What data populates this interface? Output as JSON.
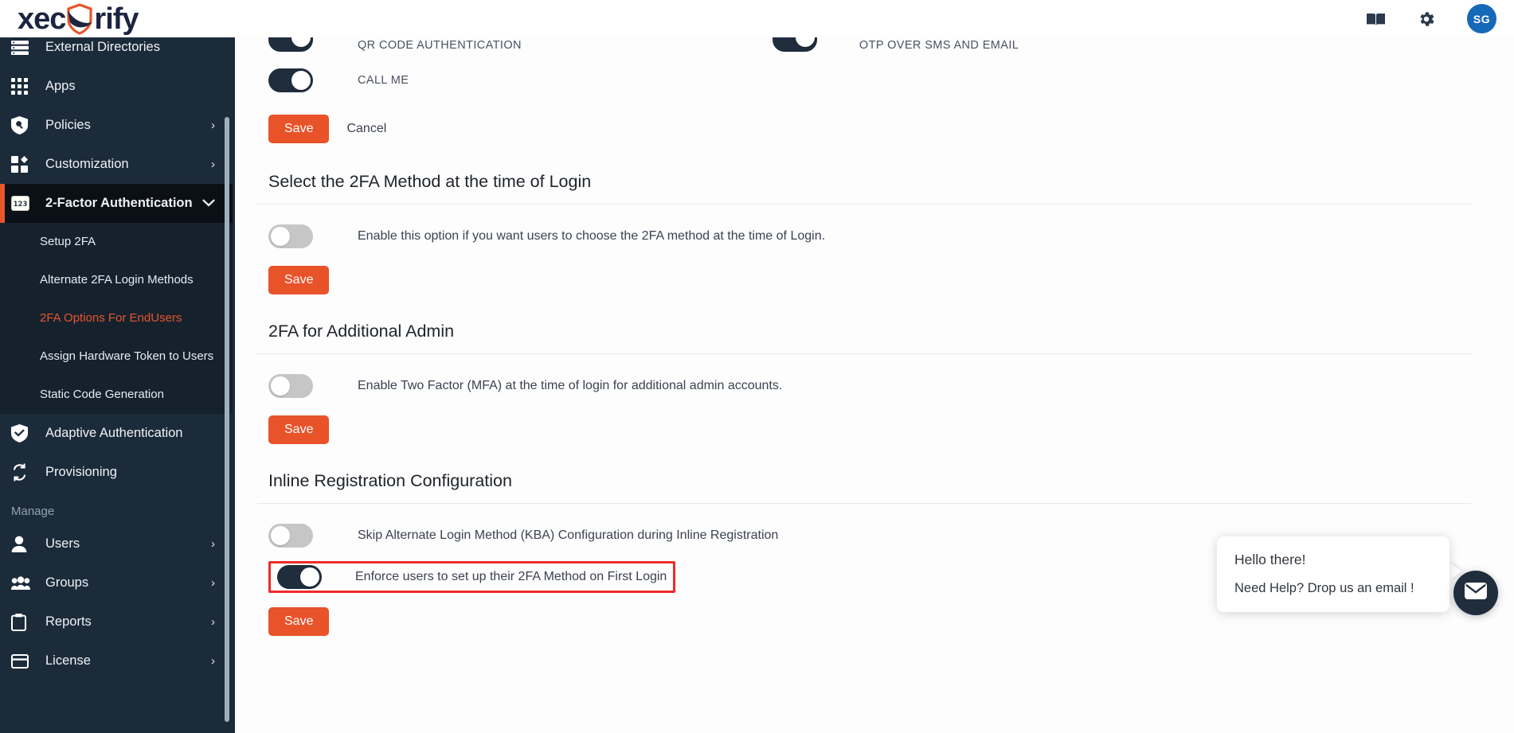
{
  "brand": {
    "name_part1": "xec",
    "name_part2": "rify",
    "shield_icon": "shield-icon"
  },
  "header": {
    "docs_icon": "book-icon",
    "settings_icon": "gear-icon",
    "avatar_initials": "SG"
  },
  "sidebar": {
    "items": [
      {
        "label": "External Directories",
        "icon": "directories-icon",
        "chevron": ""
      },
      {
        "label": "Apps",
        "icon": "apps-grid-icon",
        "chevron": ""
      },
      {
        "label": "Policies",
        "icon": "policy-shield-icon",
        "chevron": "›"
      },
      {
        "label": "Customization",
        "icon": "customization-icon",
        "chevron": "›"
      }
    ],
    "active_item": {
      "label": "2-Factor Authentication",
      "icon": "numpad-123-icon",
      "chevron": "⌄"
    },
    "sub_items": [
      {
        "label": "Setup 2FA",
        "current": false
      },
      {
        "label": "Alternate 2FA Login Methods",
        "current": false
      },
      {
        "label": "2FA Options For EndUsers",
        "current": true
      },
      {
        "label": "Assign Hardware Token to Users",
        "current": false
      },
      {
        "label": "Static Code Generation",
        "current": false
      }
    ],
    "items_after": [
      {
        "label": "Adaptive Authentication",
        "icon": "shield-check-icon",
        "chevron": ""
      },
      {
        "label": "Provisioning",
        "icon": "sync-icon",
        "chevron": ""
      }
    ],
    "section_manage": "Manage",
    "manage_items": [
      {
        "label": "Users",
        "icon": "user-icon",
        "chevron": "›"
      },
      {
        "label": "Groups",
        "icon": "groups-icon",
        "chevron": "›"
      },
      {
        "label": "Reports",
        "icon": "clipboard-icon",
        "chevron": "›"
      },
      {
        "label": "License",
        "icon": "card-icon",
        "chevron": "›"
      }
    ]
  },
  "main": {
    "method_toggles": [
      {
        "label": "QR CODE AUTHENTICATION",
        "on": true
      },
      {
        "label": "OTP OVER SMS AND EMAIL",
        "on": true
      },
      {
        "label": "CALL ME",
        "on": true
      }
    ],
    "methods_save": "Save",
    "methods_cancel": "Cancel",
    "section_select_2fa": {
      "title": "Select the 2FA Method at the time of Login",
      "option_label": "Enable this option if you want users to choose the 2FA method at the time of Login.",
      "option_on": false,
      "save_label": "Save"
    },
    "section_additional_admin": {
      "title": "2FA for Additional Admin",
      "option_label": "Enable Two Factor (MFA) at the time of login for additional admin accounts.",
      "option_on": false,
      "save_label": "Save"
    },
    "section_inline_registration": {
      "title": "Inline Registration Configuration",
      "option1_label": "Skip Alternate Login Method (KBA) Configuration during Inline Registration",
      "option1_on": false,
      "option2_label": "Enforce users to set up their 2FA Method on First Login",
      "option2_on": true,
      "option2_highlighted": true,
      "save_label": "Save"
    }
  },
  "chat_widget": {
    "greeting": "Hello there!",
    "prompt": "Need Help? Drop us an email !",
    "fab_icon": "envelope-icon"
  },
  "colors": {
    "accent_orange": "#e8532a",
    "sidebar_bg": "#1c2b3a",
    "sidebar_active_bg": "#0b1016",
    "toggle_on": "#1f2d3d",
    "toggle_off": "#c6c6c6",
    "avatar_blue": "#1668b8",
    "highlight_red": "#ef2b2b"
  }
}
